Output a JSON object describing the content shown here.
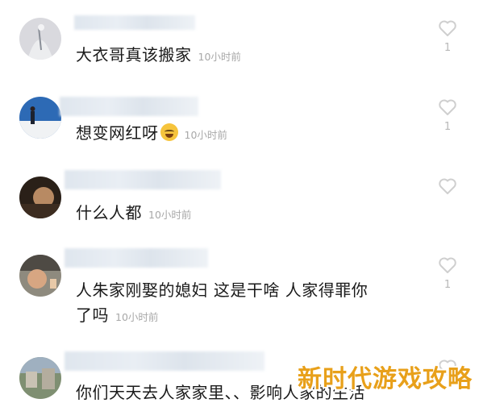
{
  "comments": [
    {
      "text": "大衣哥真该搬家",
      "time": "10小时前",
      "likes": "1"
    },
    {
      "text": "想变网红呀",
      "emoji": "grimacing-face",
      "time": "10小时前",
      "likes": "1"
    },
    {
      "text": "什么人都",
      "time": "10小时前",
      "likes": ""
    },
    {
      "text": "人朱家刚娶的媳妇 这是干啥 人家得罪你",
      "text_line2": "了吗",
      "time": "10小时前",
      "likes": "1"
    },
    {
      "text": "你们天天去人家家里、、影响人家的生活",
      "time": "",
      "likes": ""
    }
  ],
  "icons": {
    "like": "heart-outline-icon"
  },
  "colors": {
    "like_icon": "#cfcfcf",
    "time_text": "#a8a8a8",
    "watermark": "#e8a01a"
  },
  "watermark": {
    "text": "新时代游戏攻略"
  }
}
